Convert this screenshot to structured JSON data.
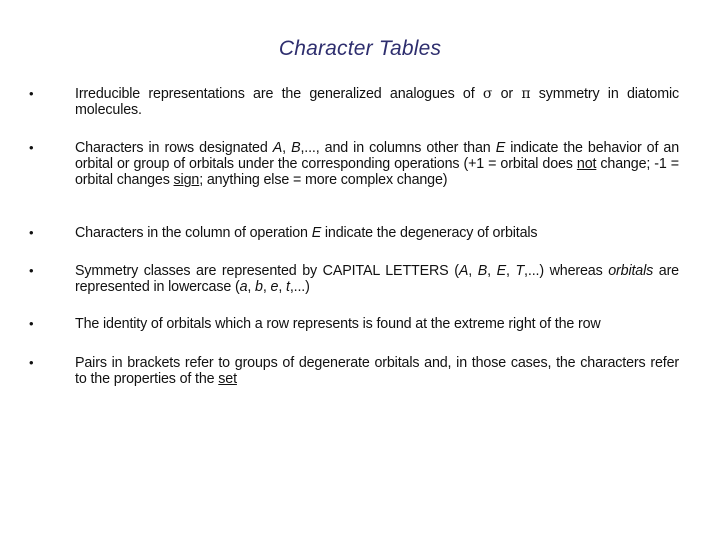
{
  "slide": {
    "title": "Character Tables",
    "title_color": "#2e2e6e",
    "bullet_symbol": "•",
    "bullets": [
      {
        "segments": [
          {
            "t": "Irreducible representations are the generalized analogues of ",
            "s": ""
          },
          {
            "t": "σ",
            "s": "greek"
          },
          {
            "t": " or ",
            "s": ""
          },
          {
            "t": "π",
            "s": "greek"
          },
          {
            "t": " symmetry in diatomic molecules.",
            "s": ""
          }
        ]
      },
      {
        "segments": [
          {
            "t": "Characters in rows designated ",
            "s": ""
          },
          {
            "t": "A",
            "s": "i"
          },
          {
            "t": ", ",
            "s": ""
          },
          {
            "t": "B",
            "s": "i"
          },
          {
            "t": ",..., and in columns other than ",
            "s": ""
          },
          {
            "t": "E",
            "s": "i"
          },
          {
            "t": " indicate the behavior of an orbital or group of orbitals under the corresponding operations (+1 = orbital does ",
            "s": ""
          },
          {
            "t": "not",
            "s": "u"
          },
          {
            "t": " change; -1 = orbital changes ",
            "s": ""
          },
          {
            "t": "sign",
            "s": "u"
          },
          {
            "t": "; anything else = more complex change)",
            "s": ""
          }
        ]
      },
      {
        "segments": [
          {
            "t": "Characters in the column of operation ",
            "s": ""
          },
          {
            "t": "E",
            "s": "i"
          },
          {
            "t": " indicate the degeneracy of orbitals",
            "s": ""
          }
        ]
      },
      {
        "segments": [
          {
            "t": "Symmetry classes are represented by CAPITAL LETTERS (",
            "s": ""
          },
          {
            "t": "A",
            "s": "i"
          },
          {
            "t": ", ",
            "s": ""
          },
          {
            "t": "B",
            "s": "i"
          },
          {
            "t": ", ",
            "s": ""
          },
          {
            "t": "E",
            "s": "i"
          },
          {
            "t": ", ",
            "s": ""
          },
          {
            "t": "T",
            "s": "i"
          },
          {
            "t": ",...) whereas ",
            "s": ""
          },
          {
            "t": "orbitals",
            "s": "i"
          },
          {
            "t": " are represented in lowercase (",
            "s": ""
          },
          {
            "t": "a",
            "s": "i"
          },
          {
            "t": ", ",
            "s": ""
          },
          {
            "t": "b",
            "s": "i"
          },
          {
            "t": ", ",
            "s": ""
          },
          {
            "t": "e",
            "s": "i"
          },
          {
            "t": ", ",
            "s": ""
          },
          {
            "t": "t",
            "s": "i"
          },
          {
            "t": ",...)",
            "s": ""
          }
        ]
      },
      {
        "segments": [
          {
            "t": "The identity of orbitals which a row represents is found at the extreme right of the row",
            "s": ""
          }
        ]
      },
      {
        "segments": [
          {
            "t": "Pairs in  brackets refer to groups of degenerate orbitals and, in those cases, the characters refer to the properties of the ",
            "s": ""
          },
          {
            "t": "set",
            "s": "u"
          }
        ]
      }
    ]
  }
}
